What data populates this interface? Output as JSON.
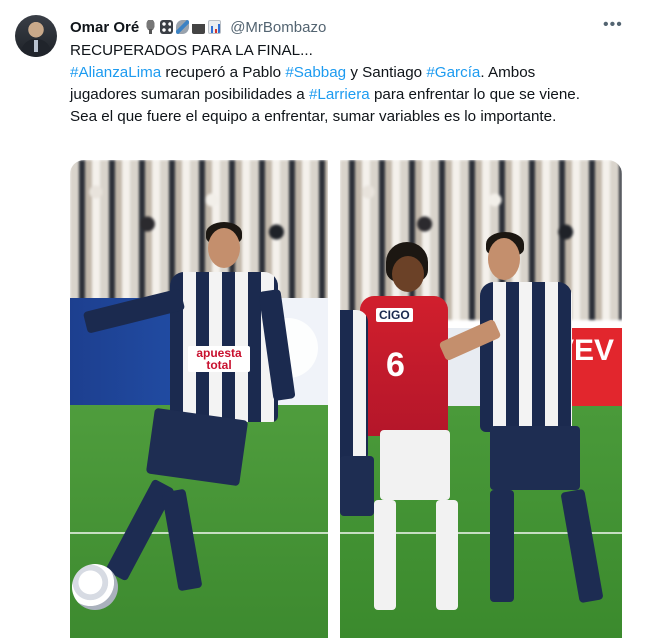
{
  "tweet": {
    "author_name": "Omar Oré",
    "author_handle": "@MrBombazo",
    "name_emojis": [
      "microphone-icon",
      "control-knobs-icon",
      "satellite-icon",
      "radio-icon",
      "bar-chart-icon"
    ],
    "more_label": "•••",
    "line1": "RECUPERADOS PARA LA FINAL...",
    "body": {
      "ht_alianza": "#AlianzaLima",
      "t1": " recuperó a Pablo ",
      "ht_sabbag": "#Sabbag",
      "t2": " y Santiago ",
      "ht_garcia": "#García",
      "t3": ". Ambos jugadores sumaran posibilidades a ",
      "ht_larriera": "#Larriera",
      "t4": " para enfrentar lo que se viene. Sea el que fuere el equipo a enfrentar, sumar variables es lo importante."
    }
  },
  "media": {
    "photo_left": {
      "sponsor": "apuesta total",
      "banner_color": "#2354b0"
    },
    "photo_right": {
      "sponsor": "CIGO",
      "number": "6",
      "banner_text": "VEV",
      "banner_color": "#e2262d"
    }
  },
  "colors": {
    "hashtag": "#1d9bf0",
    "text": "#0f1419",
    "muted": "#536471"
  }
}
